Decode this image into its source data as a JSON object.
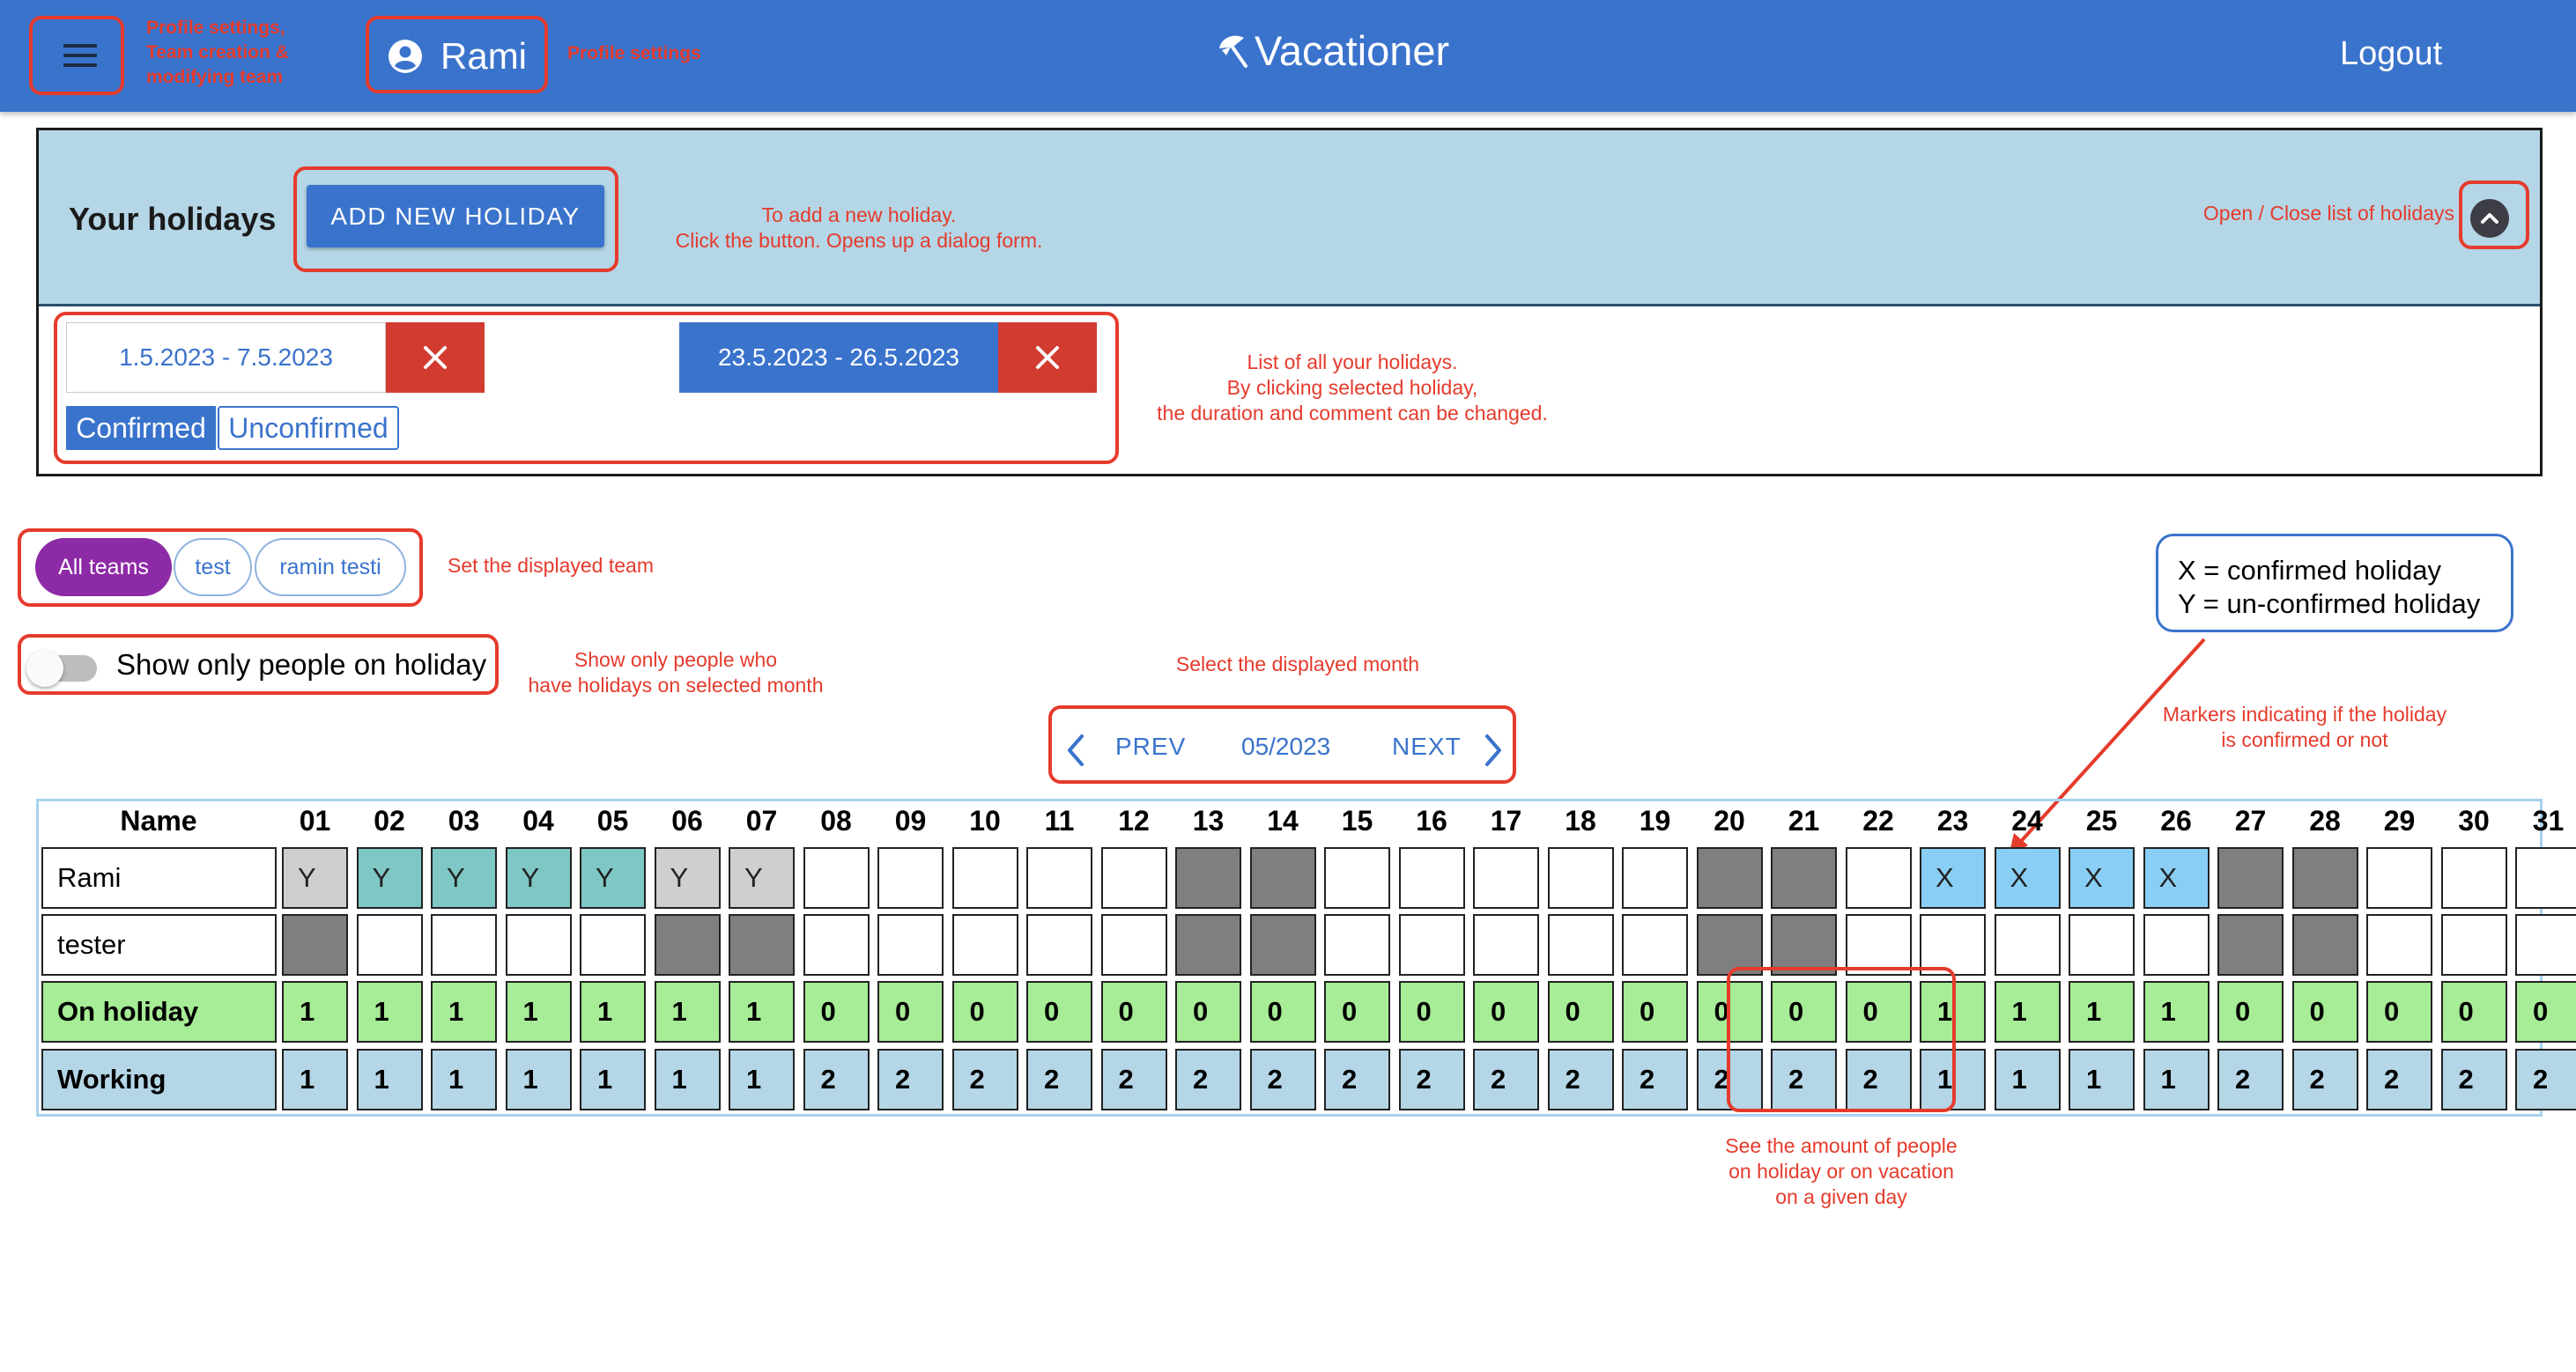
{
  "app": {
    "title": "Vacationer",
    "user_name": "Rami",
    "logout_label": "Logout"
  },
  "annotations": {
    "menu": "Profile settings,\nTeam creation &\nmodifying team",
    "profile": "Profile settings",
    "add_holiday": "To add a new holiday.\nClick the button. Opens up a dialog form.",
    "toggle_list": "Open / Close list of holidays",
    "holiday_list": "List of all your holidays.\nBy clicking selected holiday,\nthe duration and comment can be changed.",
    "teams": "Set the displayed team",
    "show_only": "Show only people who\nhave holidays on selected month",
    "month": "Select the displayed month",
    "markers": "Markers indicating if the holiday\nis confirmed or not",
    "counts": "See the amount of people\non holiday or on vacation\non a given day"
  },
  "holidays_panel": {
    "title": "Your holidays",
    "add_button": "ADD NEW HOLIDAY",
    "holidays": [
      {
        "dates": "1.5.2023 - 7.5.2023",
        "selected": false
      },
      {
        "dates": "23.5.2023 - 26.5.2023",
        "selected": true
      }
    ],
    "filter_chips": [
      "Confirmed",
      "Unconfirmed"
    ],
    "active_chip": "Confirmed"
  },
  "teams": {
    "items": [
      "All teams",
      "test",
      "ramin testi"
    ],
    "active": "All teams"
  },
  "toggle": {
    "label": "Show only people on holiday",
    "on": false
  },
  "month_nav": {
    "prev": "PREV",
    "month": "05/2023",
    "next": "NEXT"
  },
  "legend": {
    "line1": "X = confirmed holiday",
    "line2": "Y = un-confirmed holiday"
  },
  "calendar": {
    "name_header": "Name",
    "days": [
      "01",
      "02",
      "03",
      "04",
      "05",
      "06",
      "07",
      "08",
      "09",
      "10",
      "11",
      "12",
      "13",
      "14",
      "15",
      "16",
      "17",
      "18",
      "19",
      "20",
      "21",
      "22",
      "23",
      "24",
      "25",
      "26",
      "27",
      "28",
      "29",
      "30",
      "31"
    ],
    "colors": {
      "weekend": "#7f7f7f",
      "unconfirmed": "#7ec7c5",
      "unconfirmed_weekend": "#cfcfcf",
      "confirmed": "#89cff5",
      "on_holiday_row": "#a7ec96",
      "working_row": "#b4d6e6"
    },
    "rows": [
      {
        "name": "Rami",
        "cells": [
          "Y",
          "Y",
          "Y",
          "Y",
          "Y",
          "Y",
          "Y",
          "",
          "",
          "",
          "",
          "",
          "",
          "",
          "",
          "",
          "",
          "",
          "",
          "",
          "",
          "",
          "X",
          "X",
          "X",
          "X",
          "",
          "",
          "",
          "",
          ""
        ],
        "weekend": [
          1,
          6,
          7,
          13,
          14,
          20,
          21,
          27,
          28
        ]
      },
      {
        "name": "tester",
        "cells": [
          "",
          "",
          "",
          "",
          "",
          "",
          "",
          "",
          "",
          "",
          "",
          "",
          "",
          "",
          "",
          "",
          "",
          "",
          "",
          "",
          "",
          "",
          "",
          "",
          "",
          "",
          "",
          "",
          "",
          "",
          ""
        ],
        "weekend": [
          1,
          6,
          7,
          13,
          14,
          20,
          21,
          27,
          28
        ]
      }
    ],
    "summary": [
      {
        "label": "On holiday",
        "values": [
          "1",
          "1",
          "1",
          "1",
          "1",
          "1",
          "1",
          "0",
          "0",
          "0",
          "0",
          "0",
          "0",
          "0",
          "0",
          "0",
          "0",
          "0",
          "0",
          "0",
          "0",
          "0",
          "1",
          "1",
          "1",
          "1",
          "0",
          "0",
          "0",
          "0",
          "0"
        ]
      },
      {
        "label": "Working",
        "values": [
          "1",
          "1",
          "1",
          "1",
          "1",
          "1",
          "1",
          "2",
          "2",
          "2",
          "2",
          "2",
          "2",
          "2",
          "2",
          "2",
          "2",
          "2",
          "2",
          "2",
          "2",
          "2",
          "1",
          "1",
          "1",
          "1",
          "2",
          "2",
          "2",
          "2",
          "2"
        ]
      }
    ]
  }
}
